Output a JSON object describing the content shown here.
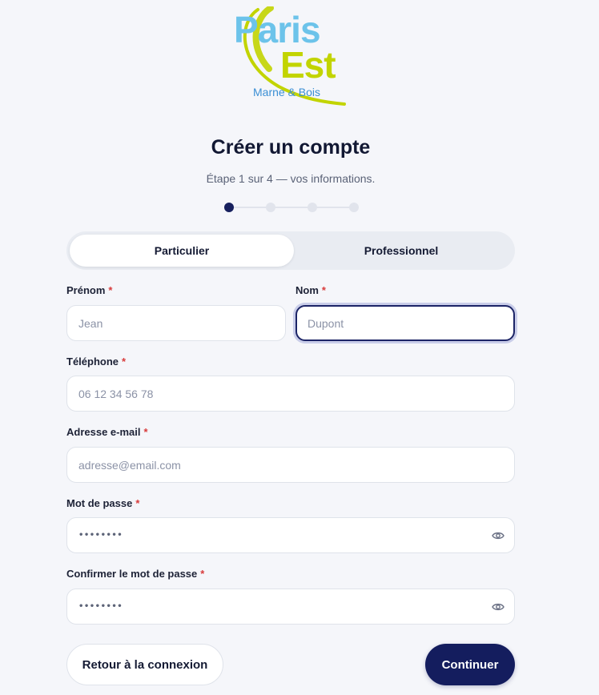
{
  "logo": {
    "line1": "Paris",
    "line2": "Est",
    "line3": "Marne & Bois",
    "colors": {
      "paris": "#6cc3ea",
      "est": "#c2d400",
      "sub": "#3b8fd4"
    }
  },
  "header": {
    "title": "Créer un compte",
    "subtitle": "Étape 1 sur 4 — vos informations."
  },
  "stepper": {
    "total_steps": 4,
    "current_step": 1
  },
  "account_type": {
    "options": [
      "Particulier",
      "Professionnel"
    ],
    "selected": "Particulier"
  },
  "form": {
    "required_marker": "*",
    "first_name": {
      "label": "Prénom",
      "placeholder": "Jean",
      "value": ""
    },
    "last_name": {
      "label": "Nom",
      "placeholder": "Dupont",
      "value": ""
    },
    "phone": {
      "label": "Téléphone",
      "placeholder": "06 12 34 56 78",
      "value": ""
    },
    "email": {
      "label": "Adresse e-mail",
      "placeholder": "adresse@email.com",
      "value": ""
    },
    "password": {
      "label": "Mot de passe",
      "masked": "••••••••"
    },
    "password_confirm": {
      "label": "Confirmer le mot de passe",
      "masked": "••••••••"
    }
  },
  "actions": {
    "back_label": "Retour à la connexion",
    "continue_label": "Continuer"
  },
  "colors": {
    "primary": "#141d5e",
    "required": "#d83b3b",
    "background": "#f5f6fa"
  }
}
